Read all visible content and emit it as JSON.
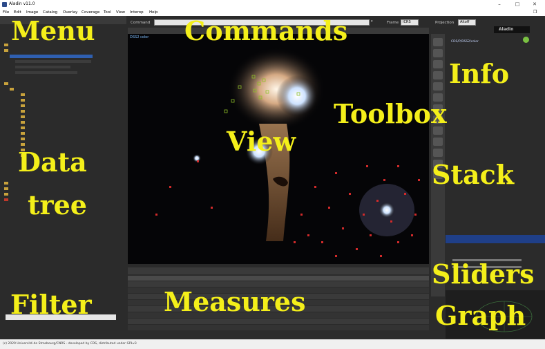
{
  "window": {
    "title": "Aladin v11.0"
  },
  "menu": [
    "File",
    "Edit",
    "Image",
    "Catalog",
    "Overlay",
    "Coverage",
    "Tool",
    "View",
    "Interop",
    "Help"
  ],
  "command": {
    "label": "Command",
    "frame_label": "Frame",
    "frame_value": "ICRS",
    "projection_label": "Projection",
    "projection_value": "Aitoff"
  },
  "view": {
    "label": "DSS2 color"
  },
  "logo": "Aladin",
  "info": {
    "hips": "CDS/P/DSS2/color"
  },
  "status_left": "(c) 2020 Université de Strasbourg/CNRS - developed by CDS, distributed under GPLv3",
  "overlay": {
    "menu": "Menu",
    "commands": "Commands",
    "info": "Info",
    "toolbox": "Toolbox",
    "view": "View",
    "data": "Data",
    "tree": "tree",
    "stack": "Stack",
    "sliders": "Sliders",
    "filter": "Filter",
    "measures": "Measures",
    "graph": "Graph"
  }
}
